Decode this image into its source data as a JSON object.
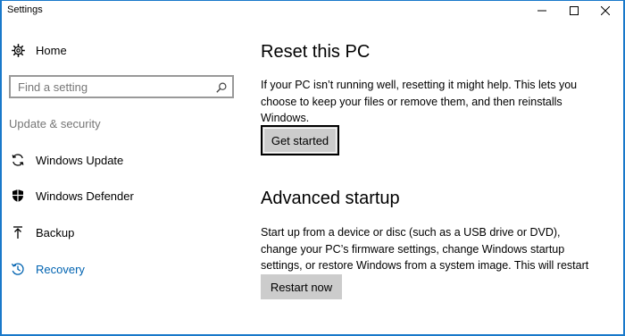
{
  "window": {
    "title": "Settings"
  },
  "sidebar": {
    "home_label": "Home",
    "search_placeholder": "Find a setting",
    "section_label": "Update & security",
    "items": [
      {
        "label": "Windows Update",
        "icon": "sync-icon"
      },
      {
        "label": "Windows Defender",
        "icon": "shield-icon"
      },
      {
        "label": "Backup",
        "icon": "upload-arrow-icon"
      },
      {
        "label": "Recovery",
        "icon": "recovery-icon",
        "active": true
      }
    ]
  },
  "main": {
    "reset": {
      "heading": "Reset this PC",
      "description": "If your PC isn’t running well, resetting it might help. This lets you choose to keep your files or remove them, and then reinstalls Windows.",
      "button_label": "Get started"
    },
    "advanced": {
      "heading": "Advanced startup",
      "description": "Start up from a device or disc (such as a USB drive or DVD), change your PC’s firmware settings, change Windows startup settings, or restore Windows from a system image. This will restart your PC.",
      "button_label": "Restart now"
    }
  },
  "colors": {
    "accent": "#0063b1",
    "window_border": "#1979ca",
    "button_bg": "#cccccc",
    "section_label": "#767676"
  }
}
